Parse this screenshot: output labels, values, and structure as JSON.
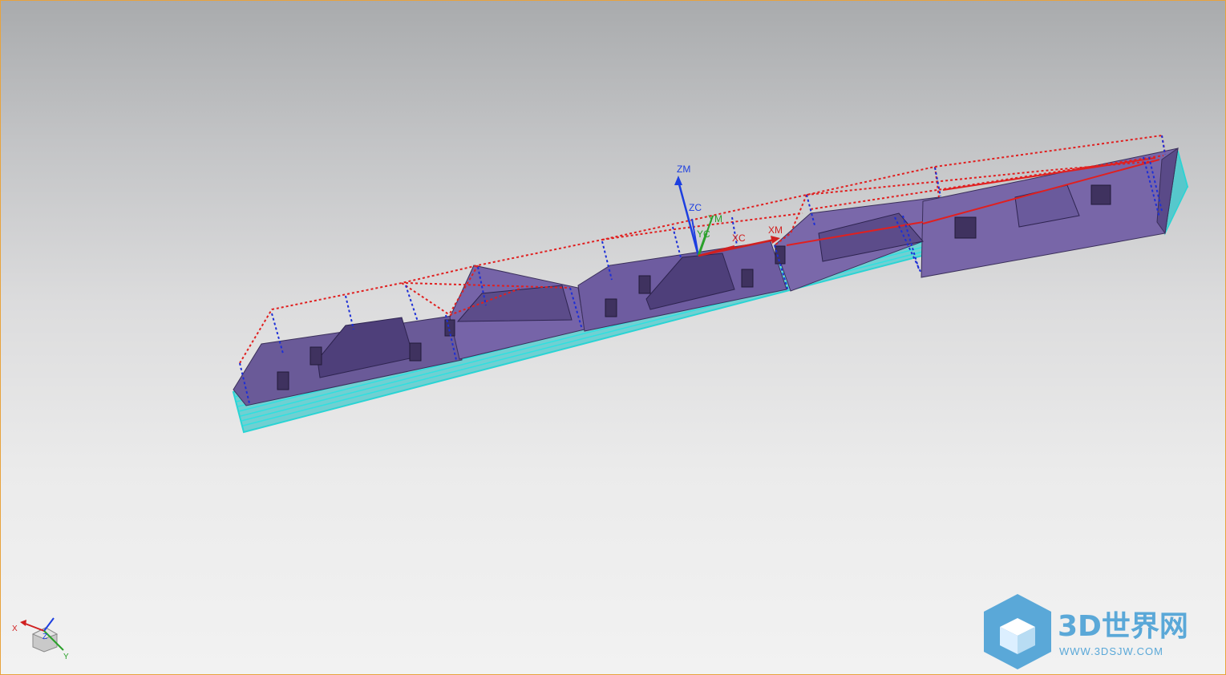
{
  "app": "NX CAM viewport",
  "colors": {
    "part_body": "#6f5c9c",
    "part_top": "#5d4a8a",
    "stock_layers": "#38d8d8",
    "toolpath_rapid": "#e02020",
    "toolpath_feed": "#1d2fd6",
    "frame_border": "#e8a33d",
    "watermark": "#5aa8d8"
  },
  "csys_labels": {
    "zm": "ZM",
    "zc": "ZC",
    "ym": "YM",
    "yc": "YC",
    "xc": "XC",
    "xm": "XM"
  },
  "view_triad": {
    "x": "X",
    "y": "Y",
    "z": "Z"
  },
  "watermark": {
    "title": "3D世界网",
    "url": "WWW.3DSJW.COM",
    "icon": "cube-logo-icon"
  }
}
